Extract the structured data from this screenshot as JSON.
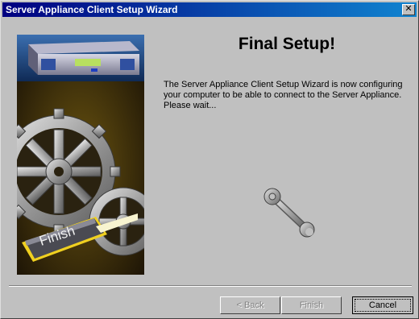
{
  "window": {
    "title": "Server Appliance Client Setup Wizard",
    "close_label": "✕"
  },
  "art": {
    "button_label": "Finish"
  },
  "main": {
    "heading": "Final Setup!",
    "body_lines": [
      "The Server Appliance Client Setup Wizard is now configuring",
      "your computer to be able to connect to the Server Appliance.",
      "Please wait..."
    ]
  },
  "buttons": {
    "back": "< Back",
    "finish": "Finish",
    "cancel": "Cancel"
  }
}
